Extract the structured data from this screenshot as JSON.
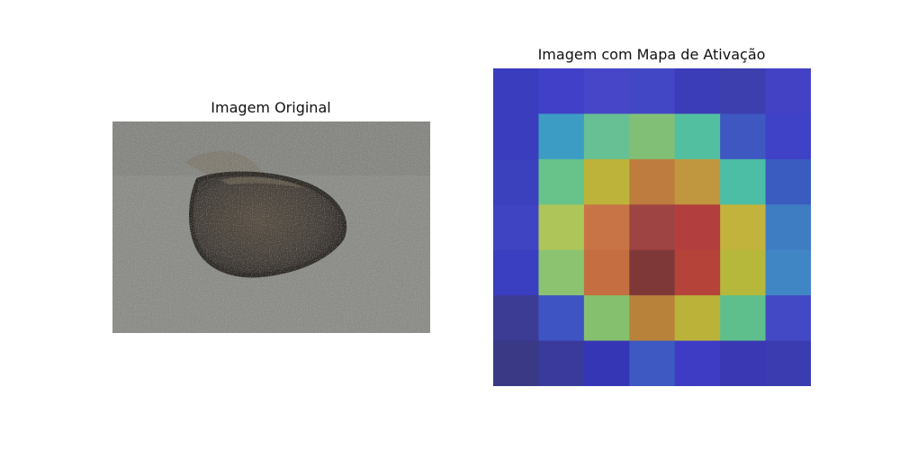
{
  "figure": {
    "left_title": "Imagem Original",
    "right_title": "Imagem com Mapa de Ativação"
  },
  "original_image": {
    "subject": "pothole in asphalt road",
    "colors": {
      "asphalt": "#8d8e8a",
      "pothole": "#4a4338",
      "edge": "#2e2a25"
    }
  },
  "activation_map": {
    "rows": 7,
    "cols": 7,
    "cells": [
      [
        "#3a3dbd",
        "#4140c8",
        "#4746c9",
        "#4248c5",
        "#3b3cb8",
        "#3d3fae",
        "#4442c4"
      ],
      [
        "#3a3dbd",
        "#3d9cc4",
        "#66c093",
        "#81bf77",
        "#52c0a0",
        "#3e57c1",
        "#3f41c7"
      ],
      [
        "#3b40bc",
        "#68c38b",
        "#bdb33b",
        "#bf7c3f",
        "#c0963e",
        "#4bbea5",
        "#3a5bbf"
      ],
      [
        "#3f44c2",
        "#aec55a",
        "#c97446",
        "#9e4443",
        "#b23e3d",
        "#c2b33d",
        "#3f7dc2"
      ],
      [
        "#3a3ec0",
        "#8bc371",
        "#c56e41",
        "#7e3838",
        "#b5433a",
        "#b5b83a",
        "#4086c5"
      ],
      [
        "#3d3c95",
        "#3f54c3",
        "#85c06e",
        "#b8823a",
        "#bbb23a",
        "#5ebf8c",
        "#4349c4"
      ],
      [
        "#3a3985",
        "#393a9c",
        "#3536b5",
        "#3e59c1",
        "#3e3cc5",
        "#3a39b3",
        "#3a3cb0"
      ]
    ]
  }
}
